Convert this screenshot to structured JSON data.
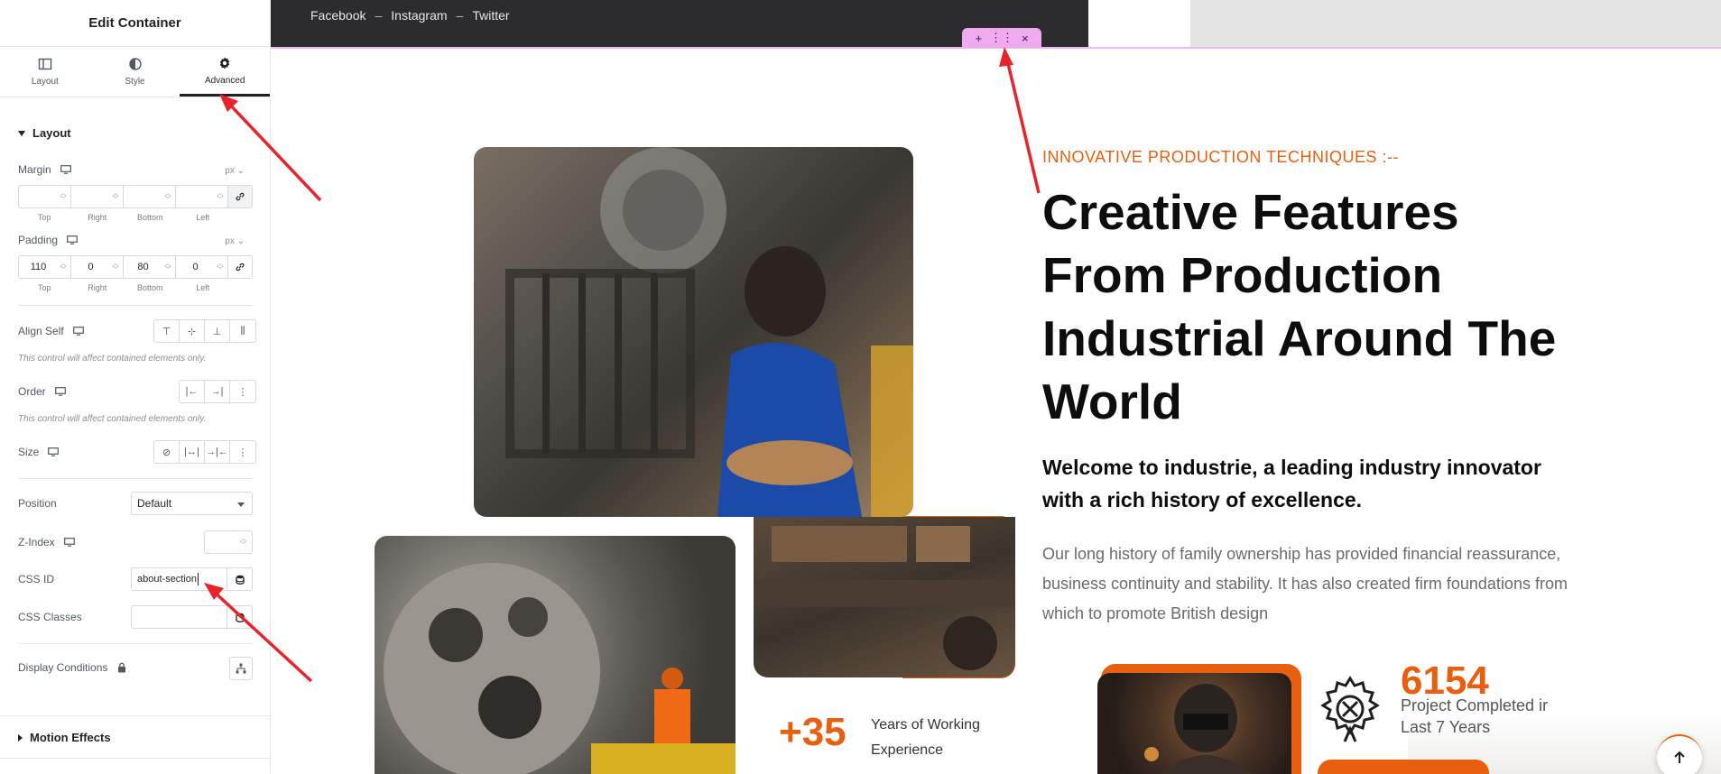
{
  "panel": {
    "title": "Edit Container",
    "tabs": [
      {
        "label": "Layout",
        "icon": "layout-icon"
      },
      {
        "label": "Style",
        "icon": "style-icon"
      },
      {
        "label": "Advanced",
        "icon": "gear-icon",
        "active": true
      }
    ],
    "layout_section": "Layout",
    "margin": {
      "label": "Margin",
      "unit": "px",
      "values": [
        "",
        "",
        "",
        ""
      ],
      "sides": [
        "Top",
        "Right",
        "Bottom",
        "Left"
      ]
    },
    "padding": {
      "label": "Padding",
      "unit": "px",
      "values": [
        "110",
        "0",
        "80",
        "0"
      ],
      "sides": [
        "Top",
        "Right",
        "Bottom",
        "Left"
      ]
    },
    "align_self": {
      "label": "Align Self",
      "hint": "This control will affect contained elements only."
    },
    "order": {
      "label": "Order",
      "hint": "This control will affect contained elements only."
    },
    "size": {
      "label": "Size"
    },
    "position": {
      "label": "Position",
      "value": "Default"
    },
    "z_index": {
      "label": "Z-Index",
      "value": ""
    },
    "css_id": {
      "label": "CSS ID",
      "value": "about-section"
    },
    "css_classes": {
      "label": "CSS Classes",
      "value": ""
    },
    "display_conditions": {
      "label": "Display Conditions"
    },
    "motion_effects": "Motion Effects"
  },
  "canvas": {
    "social": [
      "Facebook",
      "–",
      "Instagram",
      "–",
      "Twitter"
    ],
    "edit_tools": [
      "+",
      "⋮⋮",
      "×"
    ],
    "kicker": "INNOVATIVE PRODUCTION TECHNIQUES :--",
    "headline": "Creative Features From Production Industrial Around The World",
    "subhead": "Welcome to industrie, a leading industry innovator with a rich history of excellence.",
    "body": "Our long history of family ownership has provided financial reassurance, business continuity and stability. It has also created firm foundations from which to promote British design",
    "years_number": "+35",
    "years_label": "Years of Working Experience",
    "stat_number": "6154",
    "stat_label": "Project Completed ir Last 7 Years"
  },
  "colors": {
    "accent": "#e8600f",
    "editor_outline": "#f1b8ec",
    "arrow": "#e8242b"
  }
}
